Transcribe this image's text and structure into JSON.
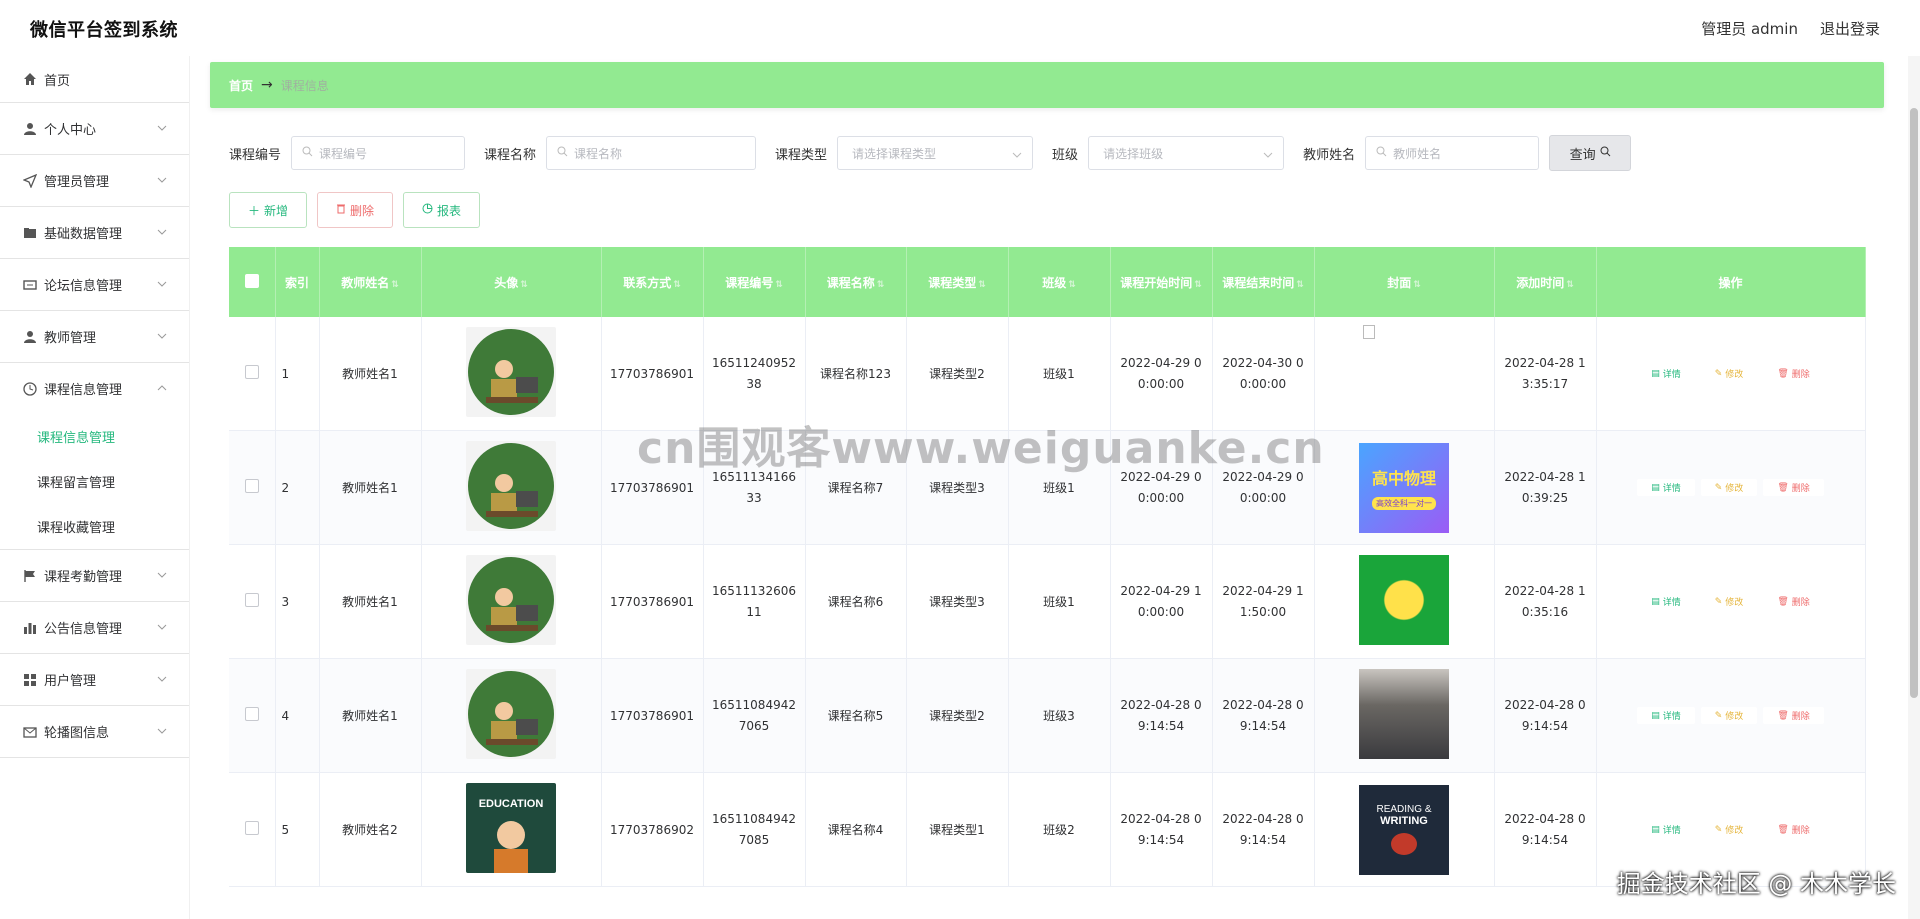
{
  "app": {
    "title": "微信平台签到系统"
  },
  "header": {
    "user_label": "管理员 admin",
    "logout_label": "退出登录"
  },
  "sidebar": {
    "items": [
      {
        "label": "首页",
        "icon": "home-icon"
      },
      {
        "label": "个人中心",
        "icon": "user-icon"
      },
      {
        "label": "管理员管理",
        "icon": "send-icon"
      },
      {
        "label": "基础数据管理",
        "icon": "folder-icon"
      },
      {
        "label": "论坛信息管理",
        "icon": "ticket-icon"
      },
      {
        "label": "教师管理",
        "icon": "user-icon"
      },
      {
        "label": "课程信息管理",
        "icon": "clock-icon",
        "expanded": true
      },
      {
        "label": "课程考勤管理",
        "icon": "flag-icon"
      },
      {
        "label": "公告信息管理",
        "icon": "bar-chart-icon"
      },
      {
        "label": "用户管理",
        "icon": "grid-icon"
      },
      {
        "label": "轮播图信息",
        "icon": "mail-icon"
      }
    ],
    "submenu": [
      {
        "label": "课程信息管理",
        "active": true
      },
      {
        "label": "课程留言管理",
        "active": false
      },
      {
        "label": "课程收藏管理",
        "active": false
      }
    ]
  },
  "breadcrumb": {
    "home": "首页",
    "current": "课程信息"
  },
  "search": {
    "course_no_label": "课程编号",
    "course_no_placeholder": "课程编号",
    "course_name_label": "课程名称",
    "course_name_placeholder": "课程名称",
    "course_type_label": "课程类型",
    "course_type_placeholder": "请选择课程类型",
    "class_label": "班级",
    "class_placeholder": "请选择班级",
    "teacher_label": "教师姓名",
    "teacher_placeholder": "教师姓名",
    "query_label": "查询"
  },
  "actions": {
    "add": "新增",
    "delete": "删除",
    "report": "报表"
  },
  "table": {
    "headers": [
      "索引",
      "教师姓名",
      "头像",
      "联系方式",
      "课程编号",
      "课程名称",
      "课程类型",
      "班级",
      "课程开始时间",
      "课程结束时间",
      "封面",
      "添加时间",
      "操作"
    ],
    "op_labels": {
      "detail": "详情",
      "edit": "修改",
      "delete": "删除"
    },
    "rows": [
      {
        "index": "1",
        "teacher": "教师姓名1",
        "phone": "17703786901",
        "course_no": "1651124095238",
        "course_name": "课程名称123",
        "course_type": "课程类型2",
        "class": "班级1",
        "start": "2022-04-29 00:00:00",
        "end": "2022-04-30 00:00:00",
        "added": "2022-04-28 13:35:17",
        "avatar": "teacher-avatar",
        "cover": "broken"
      },
      {
        "index": "2",
        "teacher": "教师姓名1",
        "phone": "17703786901",
        "course_no": "1651113416633",
        "course_name": "课程名称7",
        "course_type": "课程类型3",
        "class": "班级1",
        "start": "2022-04-29 00:00:00",
        "end": "2022-04-29 00:00:00",
        "added": "2022-04-28 10:39:25",
        "avatar": "teacher-avatar",
        "cover": "physics"
      },
      {
        "index": "3",
        "teacher": "教师姓名1",
        "phone": "17703786901",
        "course_no": "1651113260611",
        "course_name": "课程名称6",
        "course_type": "课程类型3",
        "class": "班级1",
        "start": "2022-04-29 10:00:00",
        "end": "2022-04-29 11:50:00",
        "added": "2022-04-28 10:35:16",
        "avatar": "teacher-avatar",
        "cover": "green"
      },
      {
        "index": "4",
        "teacher": "教师姓名1",
        "phone": "17703786901",
        "course_no": "16511084942 7065",
        "course_name": "课程名称5",
        "course_type": "课程类型2",
        "class": "班级3",
        "start": "2022-04-28 09:14:54",
        "end": "2022-04-28 09:14:54",
        "added": "2022-04-28 09:14:54",
        "avatar": "teacher-avatar",
        "cover": "classroom"
      },
      {
        "index": "5",
        "teacher": "教师姓名2",
        "phone": "17703786902",
        "course_no": "16511084942 7085",
        "course_name": "课程名称4",
        "course_type": "课程类型1",
        "class": "班级2",
        "start": "2022-04-28 09:14:54",
        "end": "2022-04-28 09:14:54",
        "added": "2022-04-28 09:14:54",
        "avatar": "education-avatar",
        "cover": "reading"
      }
    ]
  },
  "cover_texts": {
    "physics": "高中物理",
    "physics_sub": "高效全科一对一",
    "reading_1": "READING &",
    "reading_2": "WRITING",
    "education": "EDUCATION"
  },
  "watermark": {
    "center": "cn围观客www.weiguanke.cn",
    "corner": "掘金技术社区 @ 木木学长"
  },
  "colors": {
    "accent_green": "#92ea91",
    "active_text": "#25b87e",
    "danger": "#ee6b6b",
    "warning": "#e5b53b"
  }
}
